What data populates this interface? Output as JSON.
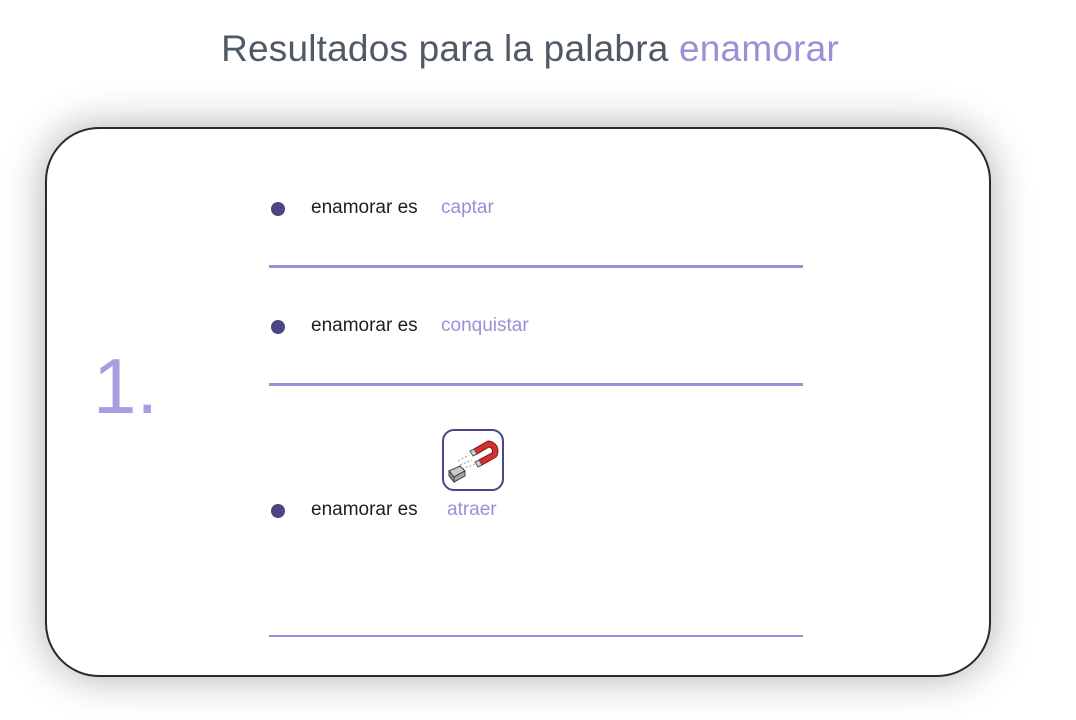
{
  "header": {
    "title_prefix": "Resultados para la palabra",
    "title_word": "enamorar"
  },
  "result": {
    "number": "1.",
    "items": [
      {
        "prefix": "enamorar es",
        "synonym": "captar"
      },
      {
        "prefix": "enamorar es",
        "synonym": "conquistar"
      },
      {
        "prefix": "enamorar es",
        "synonym": "atraer",
        "icon": "magnet-icon"
      }
    ]
  },
  "colors": {
    "accent": "#9b8fd8",
    "bullet": "#4a4583",
    "heading_text": "#505a66"
  }
}
